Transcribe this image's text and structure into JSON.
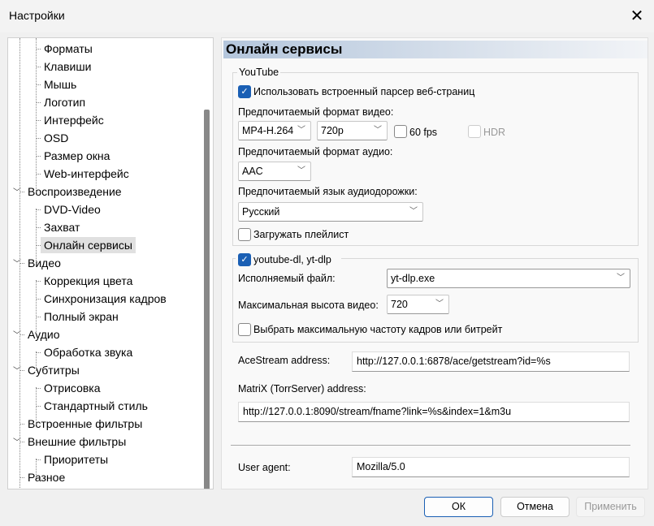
{
  "window": {
    "title": "Настройки",
    "close_icon": "close-icon"
  },
  "tree": [
    {
      "label": "Форматы",
      "level": 2
    },
    {
      "label": "Клавиши",
      "level": 2
    },
    {
      "label": "Мышь",
      "level": 2
    },
    {
      "label": "Логотип",
      "level": 2
    },
    {
      "label": "Интерфейс",
      "level": 2
    },
    {
      "label": "OSD",
      "level": 2
    },
    {
      "label": "Размер окна",
      "level": 2
    },
    {
      "label": "Web-интерфейс",
      "level": 2
    },
    {
      "label": "Воспроизведение",
      "level": 1,
      "expanded": true
    },
    {
      "label": "DVD-Video",
      "level": 2
    },
    {
      "label": "Захват",
      "level": 2
    },
    {
      "label": "Онлайн сервисы",
      "level": 2,
      "selected": true
    },
    {
      "label": "Видео",
      "level": 1,
      "expanded": true
    },
    {
      "label": "Коррекция цвета",
      "level": 2
    },
    {
      "label": "Синхронизация кадров",
      "level": 2
    },
    {
      "label": "Полный экран",
      "level": 2
    },
    {
      "label": "Аудио",
      "level": 1,
      "expanded": true
    },
    {
      "label": "Обработка звука",
      "level": 2
    },
    {
      "label": "Субтитры",
      "level": 1,
      "expanded": true
    },
    {
      "label": "Отрисовка",
      "level": 2
    },
    {
      "label": "Стандартный стиль",
      "level": 2
    },
    {
      "label": "Встроенные фильтры",
      "level": 1
    },
    {
      "label": "Внешние фильтры",
      "level": 1,
      "expanded": true
    },
    {
      "label": "Приоритеты",
      "level": 2
    },
    {
      "label": "Разное",
      "level": 1
    }
  ],
  "page": {
    "title": "Онлайн сервисы",
    "youtube": {
      "group_label": "YouTube",
      "use_parser": {
        "label": "Использовать встроенный парсер веб-страниц",
        "checked": true
      },
      "video_format_label": "Предпочитаемый формат видео:",
      "video_format": "MP4-H.264",
      "resolution": "720p",
      "fps60": {
        "label": "60 fps",
        "checked": false
      },
      "hdr": {
        "label": "HDR",
        "checked": false,
        "disabled": true
      },
      "audio_format_label": "Предпочитаемый формат аудио:",
      "audio_format": "AAC",
      "audio_lang_label": "Предпочитаемый язык аудиодорожки:",
      "audio_lang": "Русский",
      "load_playlist": {
        "label": "Загружать плейлист",
        "checked": false
      }
    },
    "ytdl": {
      "group_label": "youtube-dl, yt-dlp",
      "checked": true,
      "exe_label": "Исполняемый файл:",
      "exe": "yt-dlp.exe",
      "max_height_label": "Максимальная высота видео:",
      "max_height": "720",
      "max_fps": {
        "label": "Выбрать максимальную частоту кадров или битрейт",
        "checked": false
      }
    },
    "acestream": {
      "label": "AceStream address:",
      "value": "http://127.0.0.1:6878/ace/getstream?id=%s"
    },
    "matrix": {
      "label": "MatriX (TorrServer) address:",
      "value": "http://127.0.0.1:8090/stream/fname?link=%s&index=1&m3u"
    },
    "user_agent": {
      "label": "User agent:",
      "value": "Mozilla/5.0"
    }
  },
  "buttons": {
    "ok": "ОК",
    "cancel": "Отмена",
    "apply": "Применить"
  }
}
